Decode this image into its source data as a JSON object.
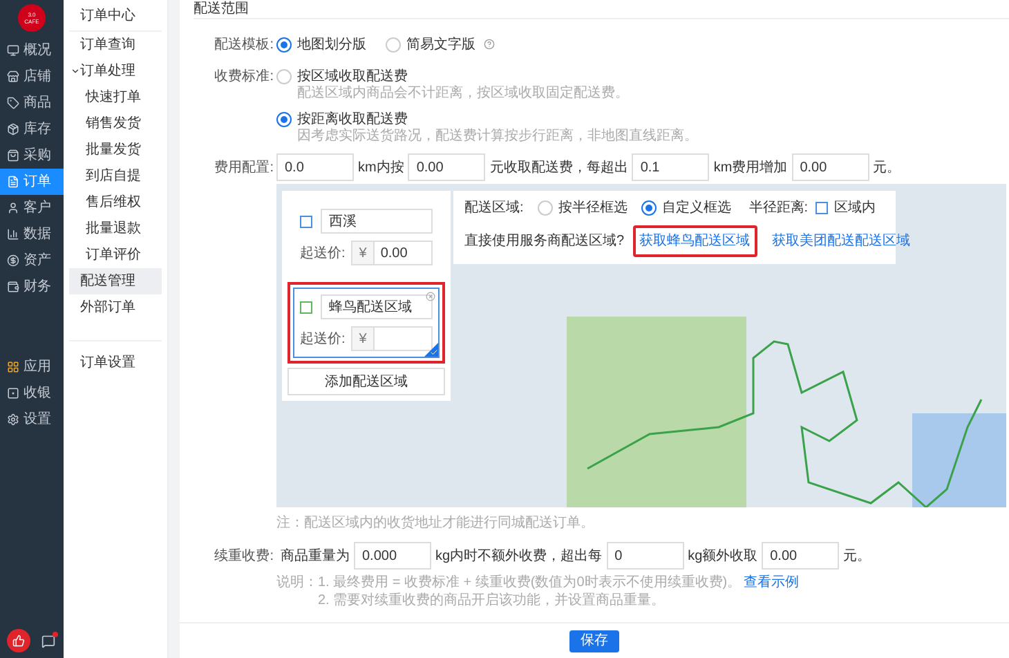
{
  "sidebar": {
    "logo": "3.0\nCAFE",
    "items": [
      {
        "label": "概况",
        "selected": false
      },
      {
        "label": "店铺",
        "selected": false
      },
      {
        "label": "商品",
        "selected": false
      },
      {
        "label": "库存",
        "selected": false
      },
      {
        "label": "采购",
        "selected": false
      },
      {
        "label": "订单",
        "selected": true
      },
      {
        "label": "客户",
        "selected": false
      },
      {
        "label": "数据",
        "selected": false
      },
      {
        "label": "资产",
        "selected": false
      },
      {
        "label": "财务",
        "selected": false
      }
    ],
    "bottom_items": [
      {
        "label": "应用"
      },
      {
        "label": "收银"
      },
      {
        "label": "设置"
      }
    ]
  },
  "subnav": {
    "title": "订单中心",
    "items": [
      {
        "label": "订单查询",
        "selected": false
      },
      {
        "label": "订单处理",
        "selected": false,
        "expanded": true,
        "children": [
          {
            "label": "快速打单",
            "selected": false
          },
          {
            "label": "销售发货",
            "selected": false
          },
          {
            "label": "批量发货",
            "selected": false
          },
          {
            "label": "到店自提",
            "selected": false
          },
          {
            "label": "售后维权",
            "selected": false
          },
          {
            "label": "批量退款",
            "selected": false
          },
          {
            "label": "订单评价",
            "selected": false
          }
        ]
      },
      {
        "label": "配送管理",
        "selected": true
      },
      {
        "label": "外部订单",
        "selected": false
      }
    ],
    "footer_items": [
      {
        "label": "订单设置",
        "selected": false
      }
    ]
  },
  "section_title": "配送范围",
  "template": {
    "label": "配送模板:",
    "options": [
      {
        "label": "地图划分版",
        "selected": true
      },
      {
        "label": "简易文字版",
        "selected": false
      }
    ]
  },
  "fee_standard": {
    "label": "收费标准:",
    "options": [
      {
        "label": "按区域收取配送费",
        "hint": "配送区域内商品会不计距离，按区域收取固定配送费。",
        "selected": false
      },
      {
        "label": "按距离收取配送费",
        "hint": "因考虑实际送货路况，配送费计算按步行距离，非地图直线距离。",
        "selected": true
      }
    ]
  },
  "cost_config": {
    "label": "费用配置:",
    "parts": [
      {
        "kind": "input",
        "value": "0.0"
      },
      {
        "kind": "text",
        "text": "km内按"
      },
      {
        "kind": "input",
        "value": "0.00"
      },
      {
        "kind": "text",
        "text": "元收取配送费，每超出"
      },
      {
        "kind": "input",
        "value": "0.1"
      },
      {
        "kind": "text",
        "text": "km费用增加"
      },
      {
        "kind": "input",
        "value": "0.00"
      },
      {
        "kind": "text",
        "text": "元。"
      }
    ]
  },
  "map": {
    "zones": [
      {
        "name": "西溪",
        "color": "#4a90e2",
        "price_label": "起送价:",
        "currency": "¥",
        "price": "0.00",
        "selected": false,
        "highlighted": false
      },
      {
        "name": "蜂鸟配送区域",
        "color": "#5cb85c",
        "price_label": "起送价:",
        "currency": "¥",
        "selected": true,
        "highlighted": true
      }
    ],
    "add_zone_button": "添加配送区域",
    "area_label": "配送区域:",
    "area_options": [
      {
        "label": "按半径框选",
        "selected": false
      },
      {
        "label": "自定义框选",
        "selected": true
      }
    ],
    "radius_label": "半径距离:",
    "radius_value": "区域内",
    "provider_question": "直接使用服务商配送区域?",
    "provider_links": [
      {
        "label": "获取蜂鸟配送区域",
        "highlighted": true
      },
      {
        "label": "获取美团配送配送区域",
        "highlighted": false
      }
    ]
  },
  "map_note": "注：配送区域内的收货地址才能进行同城配送订单。",
  "weight_fee": {
    "label": "续重收费:",
    "parts": [
      {
        "kind": "text",
        "text": "商品重量为"
      },
      {
        "kind": "input",
        "value": "0.000"
      },
      {
        "kind": "text",
        "text": "kg内时不额外收费，超出每"
      },
      {
        "kind": "input",
        "value": "0"
      },
      {
        "kind": "text",
        "text": "kg额外收取"
      },
      {
        "kind": "input",
        "value": "0.00"
      },
      {
        "kind": "text",
        "text": "元。"
      }
    ]
  },
  "explanation": {
    "label": "说明：",
    "lines": [
      "1. 最终费用 = 收费标准 + 续重收费(数值为0时表示不使用续重收费)。",
      "2. 需要对续重收费的商品开启该功能，并设置商品重量。"
    ],
    "link": "查看示例"
  },
  "save_button": "保存"
}
